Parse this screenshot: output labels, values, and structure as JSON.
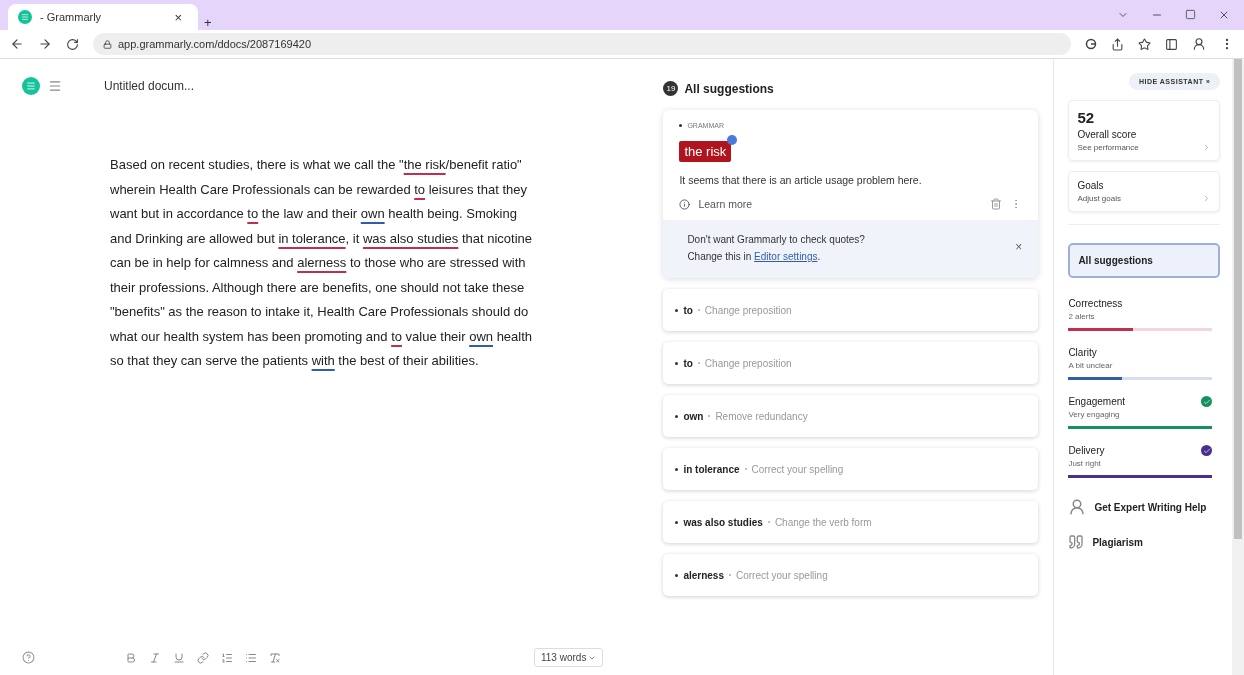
{
  "browser": {
    "tab_title": "- Grammarly",
    "tab_close": "×",
    "new_tab": "+",
    "url": "app.grammarly.com/ddocs/2087169420"
  },
  "editor": {
    "title": "Untitled docum...",
    "paragraph": [
      {
        "text": "Based on recent studies, there is what we call the \"",
        "kind": "plain"
      },
      {
        "text": "the risk",
        "kind": "error"
      },
      {
        "text": "/benefit ratio\" wherein Health Care Professionals can be rewarded ",
        "kind": "plain"
      },
      {
        "text": "to",
        "kind": "error"
      },
      {
        "text": " leisures that they want but in accordance ",
        "kind": "plain"
      },
      {
        "text": "to",
        "kind": "error"
      },
      {
        "text": " the law and their ",
        "kind": "plain"
      },
      {
        "text": "own",
        "kind": "clarity"
      },
      {
        "text": " health being. Smoking and Drinking are allowed but ",
        "kind": "plain"
      },
      {
        "text": "in tolerance",
        "kind": "error"
      },
      {
        "text": ", it ",
        "kind": "plain"
      },
      {
        "text": "was also studies",
        "kind": "error"
      },
      {
        "text": " that nicotine can be in help for calmness and ",
        "kind": "plain"
      },
      {
        "text": "alerness",
        "kind": "error"
      },
      {
        "text": " to those who are stressed with their professions. Although there are benefits, one should not take these \"benefits\" as the reason to intake it, Health Care Professionals should do what our health system has been promoting and ",
        "kind": "plain"
      },
      {
        "text": "to",
        "kind": "error"
      },
      {
        "text": " value their ",
        "kind": "plain"
      },
      {
        "text": "own",
        "kind": "clarity"
      },
      {
        "text": " health so that they can serve the patients ",
        "kind": "plain"
      },
      {
        "text": "with",
        "kind": "clarity"
      },
      {
        "text": " the best of their abilities.",
        "kind": "plain"
      }
    ],
    "word_count": "113 words"
  },
  "suggestions": {
    "count": "19",
    "title": "All suggestions",
    "active": {
      "category": "GRAMMAR",
      "highlight": "the risk",
      "message": "It seems that there is an article usage problem here.",
      "learn_more": "Learn more",
      "notice_line1": "Don't want Grammarly to check quotes?",
      "notice_line2": "Change this in ",
      "notice_link": "Editor settings",
      "notice_end": ".",
      "notice_close": "×"
    },
    "items": [
      {
        "word": "to",
        "hint": "Change preposition"
      },
      {
        "word": "to",
        "hint": "Change preposition"
      },
      {
        "word": "own",
        "hint": "Remove redundancy"
      },
      {
        "word": "in tolerance",
        "hint": "Correct your spelling"
      },
      {
        "word": "was also studies",
        "hint": "Change the verb form"
      },
      {
        "word": "alerness",
        "hint": "Correct your spelling"
      }
    ]
  },
  "sidebar": {
    "hide_button": "HIDE ASSISTANT »",
    "score": "52",
    "score_label": "Overall score",
    "score_link": "See performance",
    "goals": "Goals",
    "goals_link": "Adjust goals",
    "all_suggestions": {
      "label": "All suggestions",
      "selected": true
    },
    "categories": [
      {
        "name": "Correctness",
        "status": "2 alerts",
        "level": 0.45,
        "color": "#c0304a",
        "done": false
      },
      {
        "name": "Clarity",
        "status": "A bit unclear",
        "level": 0.37,
        "color": "#2f5fa8",
        "done": false
      },
      {
        "name": "Engagement",
        "status": "Very engaging",
        "level": 1,
        "color": "#15905f",
        "done": true
      },
      {
        "name": "Delivery",
        "status": "Just right",
        "level": 1,
        "color": "#4b2f8f",
        "done": true
      }
    ],
    "expert": "Get Expert Writing Help",
    "plagiarism": "Plagiarism"
  }
}
